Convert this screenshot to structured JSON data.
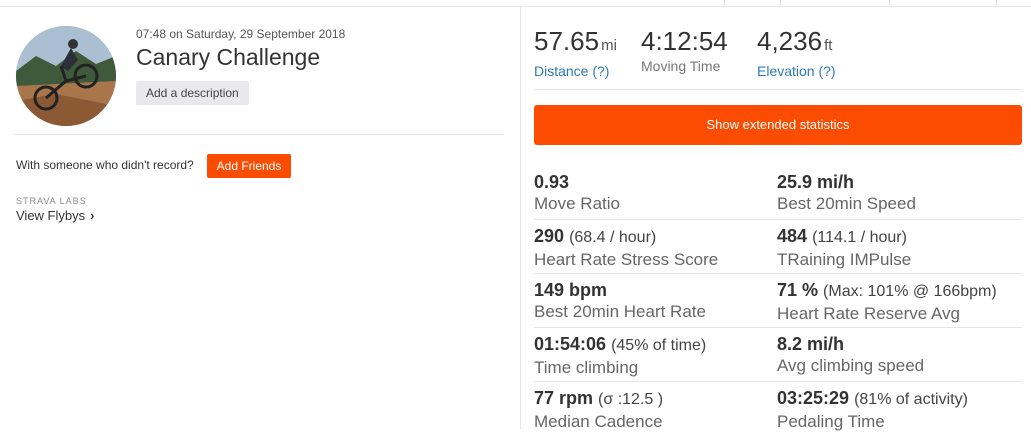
{
  "activity": {
    "datetime": "07:48 on Saturday, 29 September 2018",
    "title": "Canary Challenge",
    "add_description_label": "Add a description",
    "with_someone_text": "With someone who didn't record?",
    "add_friends_label": "Add Friends",
    "labs_label": "STRAVA LABS",
    "flybys_label": "View Flybys"
  },
  "summary": {
    "distance": {
      "value": "57.65",
      "unit": "mi",
      "label": "Distance (?)"
    },
    "moving_time": {
      "value": "4:12:54",
      "label": "Moving Time"
    },
    "elevation": {
      "value": "4,236",
      "unit": "ft",
      "label": "Elevation (?)"
    }
  },
  "extended_button_label": "Show extended statistics",
  "stats": [
    [
      {
        "value": "0.93",
        "extra": "",
        "label": "Move Ratio"
      },
      {
        "value": "25.9 mi/h",
        "extra": "",
        "label": "Best 20min Speed"
      }
    ],
    [
      {
        "value": "290",
        "extra": "(68.4 / hour)",
        "label": "Heart Rate Stress Score"
      },
      {
        "value": "484",
        "extra": "(114.1 / hour)",
        "label": "TRaining IMPulse"
      }
    ],
    [
      {
        "value": "149 bpm",
        "extra": "",
        "label": "Best 20min Heart Rate"
      },
      {
        "value": "71 %",
        "extra": "(Max: 101% @ 166bpm)",
        "label": "Heart Rate Reserve Avg"
      }
    ],
    [
      {
        "value": "01:54:06",
        "extra": "(45% of time)",
        "label": "Time climbing"
      },
      {
        "value": "8.2 mi/h",
        "extra": "",
        "label": "Avg climbing speed"
      }
    ],
    [
      {
        "value": "77 rpm",
        "extra": "(σ :12.5 )",
        "label": "Median Cadence"
      },
      {
        "value": "03:25:29",
        "extra": "(81% of activity)",
        "label": "Pedaling Time"
      }
    ]
  ],
  "colors": {
    "accent": "#fc4c02",
    "link": "#2c7ab5"
  }
}
